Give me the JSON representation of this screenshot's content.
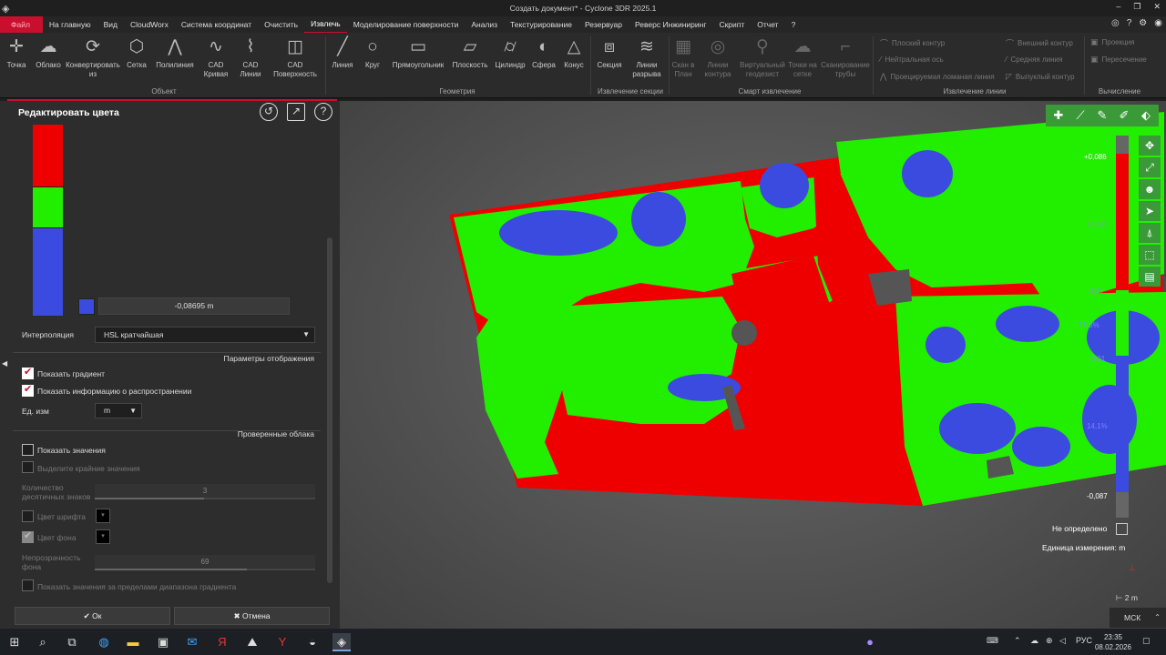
{
  "window": {
    "title": "Создать документ* - Cyclone 3DR 2025.1",
    "controls": [
      "–",
      "❐",
      "✕"
    ]
  },
  "menu": {
    "items": [
      "Файл",
      "На главную",
      "Вид",
      "CloudWorx",
      "Система координат",
      "Очистить",
      "Извлечь",
      "Моделирование поверхности",
      "Анализ",
      "Текстурирование",
      "Резервуар",
      "Реверс Инжиниринг",
      "Скрипт",
      "Отчет",
      "?"
    ],
    "active": "Извлечь"
  },
  "ribbon": {
    "object": [
      "Точка",
      "Облако",
      "Конвертировать из",
      "Сетка",
      "Полилиния",
      "CAD Кривая",
      "CAD Линии",
      "CAD Поверхность"
    ],
    "object_group": "Объект",
    "geometry": [
      "Линия",
      "Круг",
      "Прямоугольник",
      "Плоскость",
      "Цилиндр",
      "Сфера",
      "Конус"
    ],
    "geometry_group": "Геометрия",
    "section": [
      "Секция",
      "Линии разрыва"
    ],
    "section_group": "Извлечение секции",
    "smart": [
      "Скан в План",
      "Линии контура",
      "Виртуальный геодезист",
      "Точки на сетке",
      "Сканирование трубы"
    ],
    "smart_group": "Смарт извлечение",
    "lines": [
      "Плоский контур",
      "Нейтральная ось",
      "Проецируемая ломаная линия",
      "Внешний контур",
      "Средняя линия",
      "Выпуклый контур"
    ],
    "lines_group": "Извлечение линии",
    "calc": [
      "Проекция",
      "Пересечение"
    ],
    "calc_group": "Вычисление"
  },
  "panel": {
    "title": "Редактировать цвета",
    "gradient_value": "-0,08695 m",
    "interpolation_label": "Интерполяция",
    "interpolation_value": "HSL кратчайшая",
    "display_section": "Параметры отображения",
    "show_gradient": "Показать градиент",
    "show_distribution": "Показать информацию о распространении",
    "unit_label": "Ед. изм",
    "unit_value": "m",
    "checked_section": "Проверенные облака",
    "show_values": "Показать значения",
    "highlight_extremes": "Выделите крайние значения",
    "decimals_label": "Количество десятичных знаков",
    "decimals_value": "3",
    "font_color": "Цвет шрифта",
    "bg_color": "Цвет фона",
    "opacity_label": "Непрозрачность фона",
    "opacity_value": "69",
    "show_out_of_range": "Показать значения за пределами диапазона градиента",
    "ok": "Ок",
    "cancel": "Отмена"
  },
  "viewport": {
    "legend_top": "+0,086",
    "legend_mid": "0,01",
    "legend_mid2": "-0,01",
    "legend_bottom": "-0,087",
    "legend_pct_top": "14,6%",
    "legend_pct_mid": "71,3%",
    "legend_pct_low": "14,1%",
    "not_defined": "Не определено",
    "unit": "Единица измерения: m",
    "scale": "2 m",
    "coord_system": "МСК"
  },
  "taskbar": {
    "lang": "РУС",
    "time": "23:35",
    "date": "08.02.2026"
  },
  "colors": {
    "red": "#ef0000",
    "green": "#22ee00",
    "blue": "#3b4be0",
    "accent": "#c8102e"
  }
}
